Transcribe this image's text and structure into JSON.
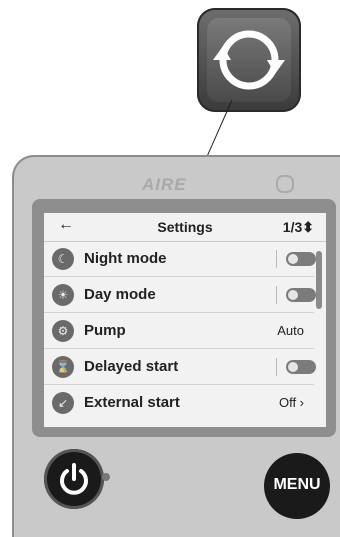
{
  "device": {
    "brand": "AIRE"
  },
  "screen": {
    "back_icon": "back-arrow-icon",
    "title": "Settings",
    "page_indicator": "1/3⬍",
    "items": [
      {
        "label": "Night mode",
        "icon": "moon-icon",
        "control": "toggle",
        "value": ""
      },
      {
        "label": "Day mode",
        "icon": "sun-icon",
        "control": "toggle",
        "value": ""
      },
      {
        "label": "Pump",
        "icon": "pump-icon",
        "control": "value",
        "value": "Auto"
      },
      {
        "label": "Delayed start",
        "icon": "hourglass-icon",
        "control": "toggle",
        "value": ""
      },
      {
        "label": "External start",
        "icon": "external-start-icon",
        "control": "value",
        "value": "Off ›"
      }
    ]
  },
  "buttons": {
    "power_icon": "power-icon",
    "menu_label": "MENU",
    "refresh_icon": "refresh-icon"
  }
}
